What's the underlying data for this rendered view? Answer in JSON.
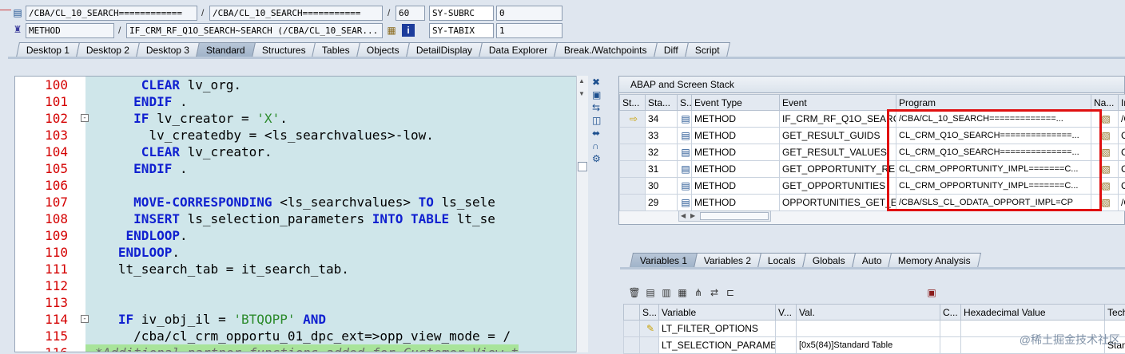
{
  "header": {
    "row1": {
      "field1": "/CBA/CL_10_SEARCH============",
      "field2": "/CBA/CL_10_SEARCH===========",
      "field3": "60",
      "sys_name": "SY-SUBRC",
      "sys_value": "0"
    },
    "row2": {
      "field1": "METHOD",
      "field2": "IF_CRM_RF_Q1O_SEARCH~SEARCH (/CBA/CL_10_SEAR...",
      "sys_name": "SY-TABIX",
      "sys_value": "1"
    }
  },
  "tabs": [
    "Desktop 1",
    "Desktop 2",
    "Desktop 3",
    "Standard",
    "Structures",
    "Tables",
    "Objects",
    "DetailDisplay",
    "Data Explorer",
    "Break./Watchpoints",
    "Diff",
    "Script"
  ],
  "editor": {
    "lines": [
      {
        "n": "100",
        "indent": "      ",
        "parts": [
          [
            "kw",
            "CLEAR"
          ],
          [
            "",
            " lv_org."
          ]
        ]
      },
      {
        "n": "101",
        "indent": "     ",
        "parts": [
          [
            "kw",
            "ENDIF"
          ],
          [
            "",
            " ."
          ]
        ]
      },
      {
        "n": "102",
        "indent": "     ",
        "fold": "-",
        "parts": [
          [
            "kw",
            "IF"
          ],
          [
            "",
            " lv_creator = "
          ],
          [
            "str",
            "'X'"
          ],
          [
            "",
            "."
          ]
        ]
      },
      {
        "n": "103",
        "indent": "       ",
        "parts": [
          [
            "",
            "lv_createdby = <ls_searchvalues>-low."
          ]
        ]
      },
      {
        "n": "104",
        "indent": "      ",
        "parts": [
          [
            "kw",
            "CLEAR"
          ],
          [
            "",
            " lv_creator."
          ]
        ]
      },
      {
        "n": "105",
        "indent": "     ",
        "parts": [
          [
            "kw",
            "ENDIF"
          ],
          [
            "",
            " ."
          ]
        ]
      },
      {
        "n": "106",
        "indent": "",
        "parts": []
      },
      {
        "n": "107",
        "indent": "     ",
        "parts": [
          [
            "kw",
            "MOVE-CORRESPONDING"
          ],
          [
            "",
            " <ls_searchvalues> "
          ],
          [
            "kw",
            "TO"
          ],
          [
            "",
            " ls_sele"
          ]
        ]
      },
      {
        "n": "108",
        "indent": "     ",
        "parts": [
          [
            "kw",
            "INSERT"
          ],
          [
            "",
            " ls_selection_parameters "
          ],
          [
            "kw",
            "INTO TABLE"
          ],
          [
            "",
            " lt_se"
          ]
        ]
      },
      {
        "n": "109",
        "indent": "    ",
        "parts": [
          [
            "kw",
            "ENDLOOP"
          ],
          [
            "",
            "."
          ]
        ]
      },
      {
        "n": "110",
        "indent": "   ",
        "parts": [
          [
            "kw",
            "ENDLOOP"
          ],
          [
            "",
            "."
          ]
        ]
      },
      {
        "n": "111",
        "indent": "   ",
        "parts": [
          [
            "",
            "lt_search_tab = it_search_tab."
          ]
        ]
      },
      {
        "n": "112",
        "indent": "",
        "parts": []
      },
      {
        "n": "113",
        "indent": "",
        "parts": []
      },
      {
        "n": "114",
        "indent": "   ",
        "fold": "-",
        "parts": [
          [
            "kw",
            "IF"
          ],
          [
            "",
            " iv_obj_il = "
          ],
          [
            "str",
            "'BTQOPP'"
          ],
          [
            "kw",
            " AND"
          ]
        ]
      },
      {
        "n": "115",
        "indent": "     ",
        "parts": [
          [
            "",
            "/cba/cl_crm_opportu_01_dpc_ext=>opp_view_mode = /"
          ]
        ]
      },
      {
        "n": "116",
        "indent": "",
        "green": true,
        "parts": [
          [
            "cmt",
            "*Additional partner functions added for Customer View t"
          ]
        ]
      }
    ]
  },
  "stack": {
    "title": "ABAP and Screen Stack",
    "columns": [
      "St...",
      "Sta...",
      "S...",
      "Event Type",
      "Event",
      "Program",
      "Na...",
      "In"
    ],
    "rows": [
      {
        "current": true,
        "sta": "34",
        "type": "METHOD",
        "event": "IF_CRM_RF_Q1O_SEARC...",
        "program": "/CBA/CL_10_SEARCH=============...",
        "inc": "/C"
      },
      {
        "current": false,
        "sta": "33",
        "type": "METHOD",
        "event": "GET_RESULT_GUIDS",
        "program": "CL_CRM_Q1O_SEARCH==============...",
        "inc": "CL"
      },
      {
        "current": false,
        "sta": "32",
        "type": "METHOD",
        "event": "GET_RESULT_VALUES",
        "program": "CL_CRM_Q1O_SEARCH==============...",
        "inc": "CL"
      },
      {
        "current": false,
        "sta": "31",
        "type": "METHOD",
        "event": "GET_OPPORTUNITY_RE...",
        "program": "CL_CRM_OPPORTUNITY_IMPL=======C...",
        "inc": "CL"
      },
      {
        "current": false,
        "sta": "30",
        "type": "METHOD",
        "event": "GET_OPPORTUNITIES",
        "program": "CL_CRM_OPPORTUNITY_IMPL=======C...",
        "inc": "CL"
      },
      {
        "current": false,
        "sta": "29",
        "type": "METHOD",
        "event": "OPPORTUNITIES_GET_E...",
        "program": "/CBA/SLS_CL_ODATA_OPPORT_IMPL=CP",
        "inc": "/C"
      }
    ]
  },
  "var_tabs": [
    "Variables 1",
    "Variables 2",
    "Locals",
    "Globals",
    "Auto",
    "Memory Analysis"
  ],
  "var_grid": {
    "columns": [
      "S...",
      "Variable",
      "V...",
      "Val.",
      "C...",
      "Hexadecimal Value",
      "Tech"
    ],
    "rows": [
      {
        "variable": "LT_FILTER_OPTIONS",
        "value": "",
        "tech": ""
      },
      {
        "variable": "LT_SELECTION_PARAME...",
        "value": "[0x5(84)]Standard Table",
        "tech": "Stan"
      }
    ]
  },
  "watermark": "@稀土掘金技术社区"
}
